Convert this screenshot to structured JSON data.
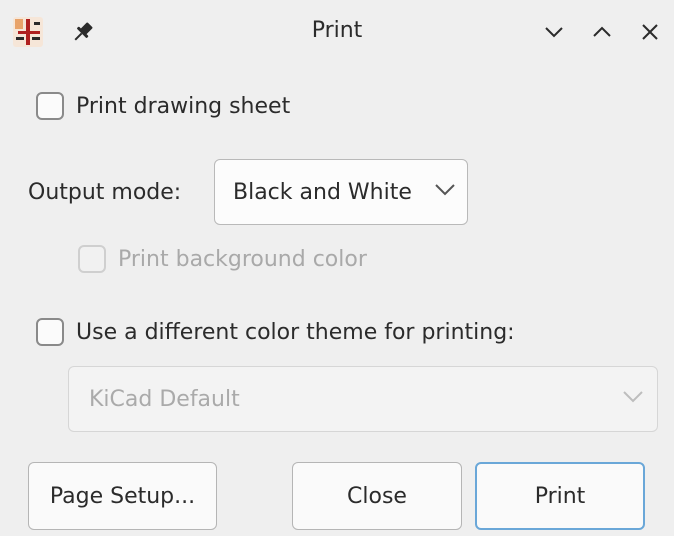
{
  "window": {
    "title": "Print",
    "icons": {
      "app": "kicad-app-icon",
      "pin": "pin-icon",
      "minimize": "chevron-down-icon",
      "maximize": "chevron-up-icon",
      "close": "close-icon"
    }
  },
  "options": {
    "print_drawing_sheet": {
      "label": "Print drawing sheet",
      "checked": false
    },
    "output_mode": {
      "label": "Output mode:",
      "value": "Black and White"
    },
    "print_background_color": {
      "label": "Print background color",
      "checked": false,
      "enabled": false
    },
    "different_color_theme": {
      "label": "Use a different color theme for printing:",
      "checked": false
    },
    "color_theme": {
      "value": "KiCad Default",
      "enabled": false
    }
  },
  "buttons": {
    "page_setup": "Page Setup...",
    "close": "Close",
    "print": "Print"
  },
  "colors": {
    "background": "#efefef",
    "primary_button_border": "#6aa7d8",
    "disabled_text": "#a9a9a9"
  }
}
